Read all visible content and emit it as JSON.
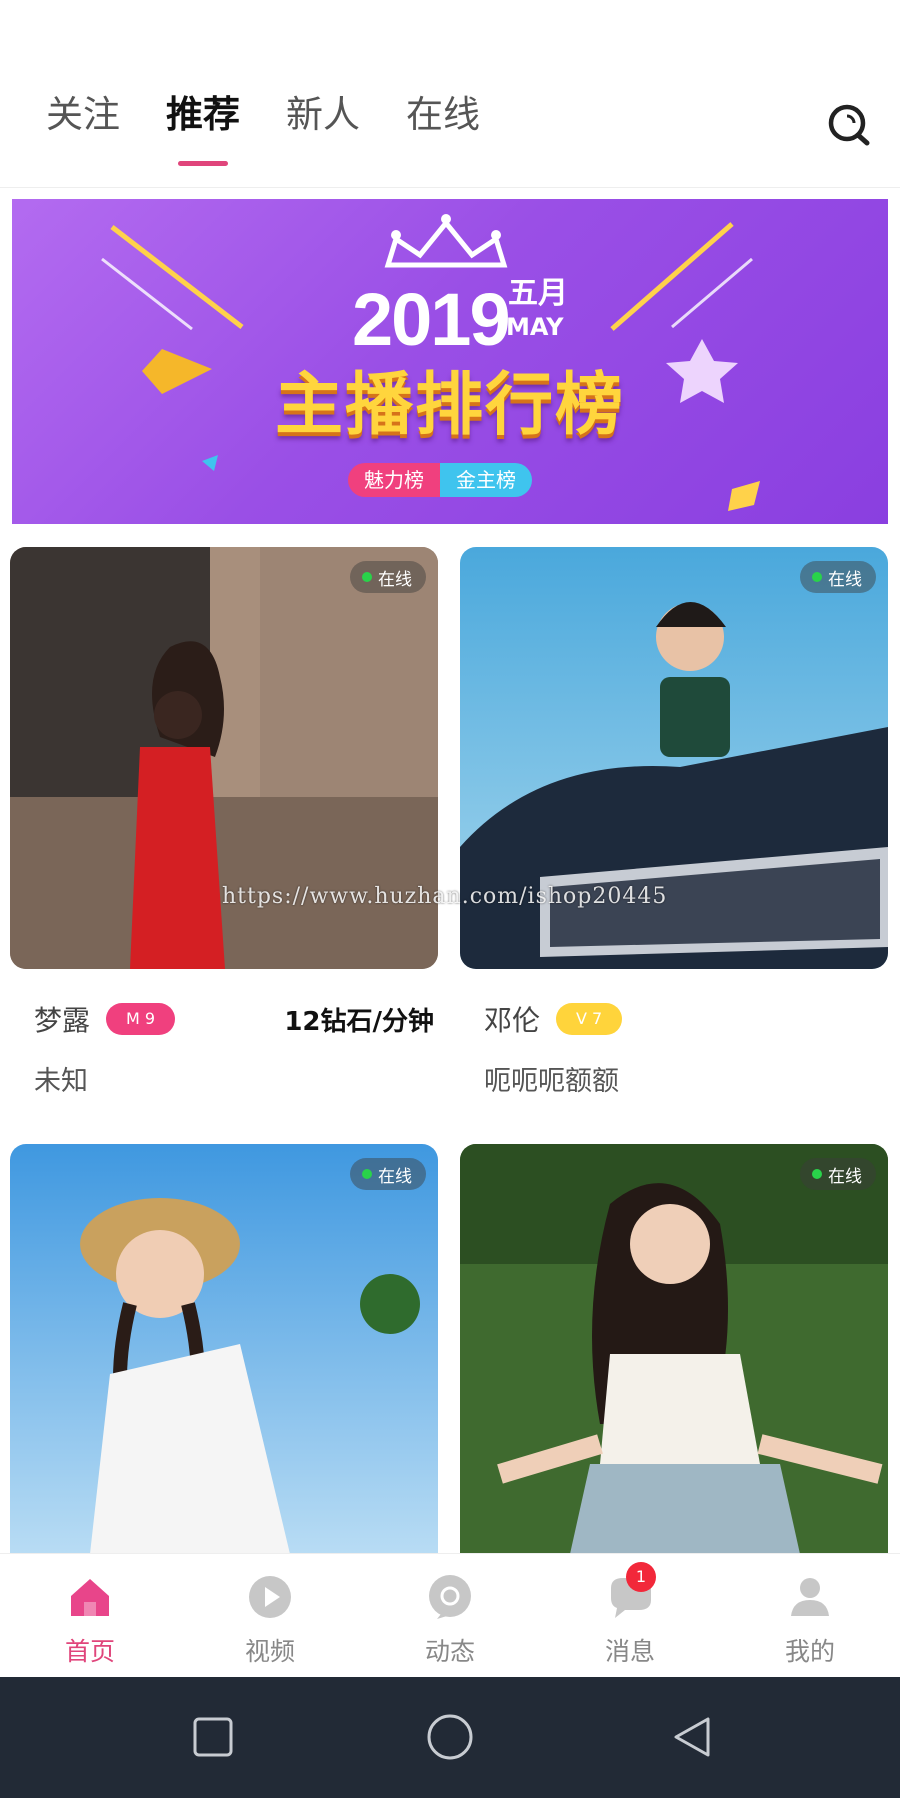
{
  "top_tabs": [
    {
      "label": "关注",
      "active": false
    },
    {
      "label": "推荐",
      "active": true
    },
    {
      "label": "新人",
      "active": false
    },
    {
      "label": "在线",
      "active": false
    }
  ],
  "search_icon": "search-icon",
  "banner": {
    "year": "2019",
    "month_cn": "五月",
    "month_en": "MAY",
    "title": "主播排行榜",
    "pill_left": "魅力榜",
    "pill_right": "金主榜"
  },
  "cards": [
    {
      "status": "在线",
      "name": "梦露",
      "level": "M 9",
      "price": "12钻石/分钟",
      "subtitle": "未知",
      "level_color": "#f0407e"
    },
    {
      "status": "在线",
      "name": "邓伦",
      "level": "V 7",
      "price": "",
      "subtitle": "呃呃呃额额",
      "level_color": "#ffd43b"
    },
    {
      "status": "在线"
    },
    {
      "status": "在线"
    }
  ],
  "watermark": "https://www.huzhan.com/ishop20445",
  "bottom_nav": [
    {
      "label": "首页",
      "icon": "home-icon",
      "active": true
    },
    {
      "label": "视频",
      "icon": "play-icon",
      "active": false
    },
    {
      "label": "动态",
      "icon": "moments-icon",
      "active": false
    },
    {
      "label": "消息",
      "icon": "message-icon",
      "active": false,
      "badge": "1"
    },
    {
      "label": "我的",
      "icon": "profile-icon",
      "active": false
    }
  ],
  "colors": {
    "accent": "#e0457b",
    "online_dot": "#29d34a",
    "banner_purple": "#9a4fe6",
    "badge_red": "#f2283a",
    "system_bar": "#222a36"
  }
}
